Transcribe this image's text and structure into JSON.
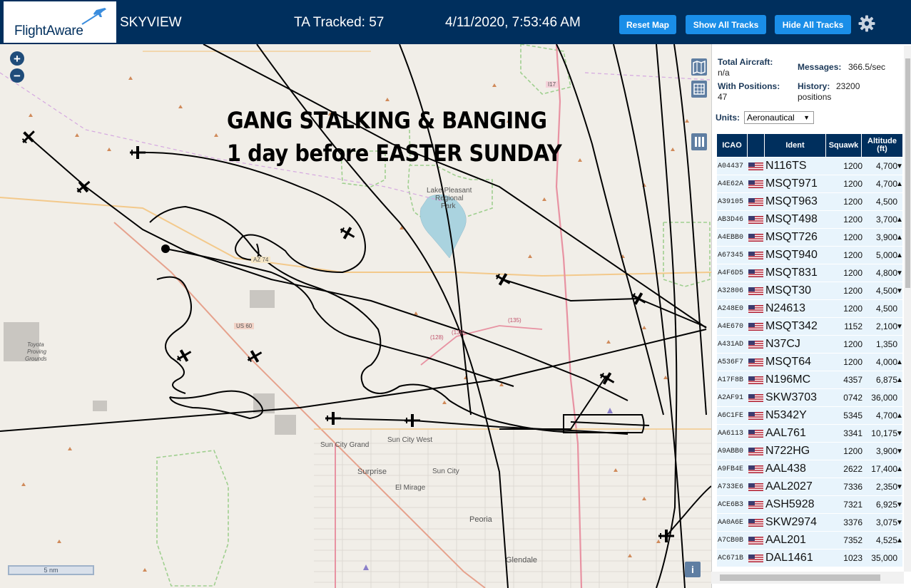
{
  "header": {
    "logo": "FlightAware",
    "app_name": "SKYVIEW",
    "tracked": "TA Tracked: 57",
    "datetime": "4/11/2020, 7:53:46 AM",
    "buttons": {
      "reset": "Reset Map",
      "show_all": "Show All Tracks",
      "hide_all": "Hide All Tracks"
    },
    "settings_icon": "gear-icon"
  },
  "map": {
    "caption_line1": "GANG STALKING & BANGING",
    "caption_line2": "1 day before EASTER SUNDAY",
    "zoom_in": "+",
    "zoom_out": "−",
    "scale": "5 nm",
    "info": "i",
    "labels": {
      "lake_pleasant": "Lake Pleasant",
      "regional": "Regional",
      "park": "Park",
      "sun_city_grand": "Sun City Grand",
      "sun_city_west": "Sun City West",
      "surprise": "Surprise",
      "sun_city": "Sun City",
      "el_mirage": "El Mirage",
      "peoria": "Peoria",
      "glendale": "Glendale",
      "toyota1": "Toyota",
      "toyota2": "Proving",
      "toyota3": "Grounds",
      "az74": "AZ 74",
      "us60": "US 60",
      "i17": "I17",
      "r130": "(130)",
      "r135": "(135)",
      "r128": "(128)"
    }
  },
  "panel": {
    "total_aircraft_label": "Total Aircraft:",
    "total_aircraft_value": "n/a",
    "with_positions_label": "With Positions:",
    "with_positions_value": "47",
    "messages_label": "Messages:",
    "messages_value": "366.5/sec",
    "history_label": "History:",
    "history_value": "23200",
    "history_unit": "positions",
    "units_label": "Units:",
    "units_value": "Aeronautical",
    "columns": [
      "ICAO",
      "Ident",
      "Squawk",
      "Altitude (ft)"
    ],
    "rows": [
      {
        "icao": "A04437",
        "ident": "N116TS",
        "squawk": "1200",
        "alt": "4,700",
        "trend": "▼"
      },
      {
        "icao": "A4E62A",
        "ident": "MSQT971",
        "squawk": "1200",
        "alt": "4,700",
        "trend": "▲"
      },
      {
        "icao": "A39105",
        "ident": "MSQT963",
        "squawk": "1200",
        "alt": "4,500",
        "trend": ""
      },
      {
        "icao": "AB3D46",
        "ident": "MSQT498",
        "squawk": "1200",
        "alt": "3,700",
        "trend": "▲"
      },
      {
        "icao": "A4EBB0",
        "ident": "MSQT726",
        "squawk": "1200",
        "alt": "3,900",
        "trend": "▲"
      },
      {
        "icao": "A67345",
        "ident": "MSQT940",
        "squawk": "1200",
        "alt": "5,000",
        "trend": "▲"
      },
      {
        "icao": "A4F6D5",
        "ident": "MSQT831",
        "squawk": "1200",
        "alt": "4,800",
        "trend": "▼"
      },
      {
        "icao": "A32806",
        "ident": "MSQT30",
        "squawk": "1200",
        "alt": "4,500",
        "trend": "▼"
      },
      {
        "icao": "A248E0",
        "ident": "N24613",
        "squawk": "1200",
        "alt": "4,500",
        "trend": ""
      },
      {
        "icao": "A4E670",
        "ident": "MSQT342",
        "squawk": "1152",
        "alt": "2,100",
        "trend": "▼"
      },
      {
        "icao": "A431AD",
        "ident": "N37CJ",
        "squawk": "1200",
        "alt": "1,350",
        "trend": ""
      },
      {
        "icao": "A536F7",
        "ident": "MSQT64",
        "squawk": "1200",
        "alt": "4,000",
        "trend": "▲"
      },
      {
        "icao": "A17F8B",
        "ident": "N196MC",
        "squawk": "4357",
        "alt": "6,875",
        "trend": "▲"
      },
      {
        "icao": "A2AF91",
        "ident": "SKW3703",
        "squawk": "0742",
        "alt": "36,000",
        "trend": ""
      },
      {
        "icao": "A6C1FE",
        "ident": "N5342Y",
        "squawk": "5345",
        "alt": "4,700",
        "trend": "▲"
      },
      {
        "icao": "AA6113",
        "ident": "AAL761",
        "squawk": "3341",
        "alt": "10,175",
        "trend": "▼"
      },
      {
        "icao": "A9ABB0",
        "ident": "N722HG",
        "squawk": "1200",
        "alt": "3,900",
        "trend": "▼"
      },
      {
        "icao": "A9FB4E",
        "ident": "AAL438",
        "squawk": "2622",
        "alt": "17,400",
        "trend": "▲"
      },
      {
        "icao": "A733E6",
        "ident": "AAL2027",
        "squawk": "7336",
        "alt": "2,350",
        "trend": "▼"
      },
      {
        "icao": "ACE6B3",
        "ident": "ASH5928",
        "squawk": "7321",
        "alt": "6,925",
        "trend": "▼"
      },
      {
        "icao": "AA0A6E",
        "ident": "SKW2974",
        "squawk": "3376",
        "alt": "3,075",
        "trend": "▼"
      },
      {
        "icao": "A7CB0B",
        "ident": "AAL201",
        "squawk": "7352",
        "alt": "4,525",
        "trend": "▲"
      },
      {
        "icao": "AC671B",
        "ident": "DAL1461",
        "squawk": "1023",
        "alt": "35,000",
        "trend": ""
      }
    ]
  },
  "colors": {
    "header_bg": "#002f5d",
    "button_bg": "#1a8ee8",
    "row_bg": "#e8f4fc",
    "map_bg": "#f1eee8"
  }
}
